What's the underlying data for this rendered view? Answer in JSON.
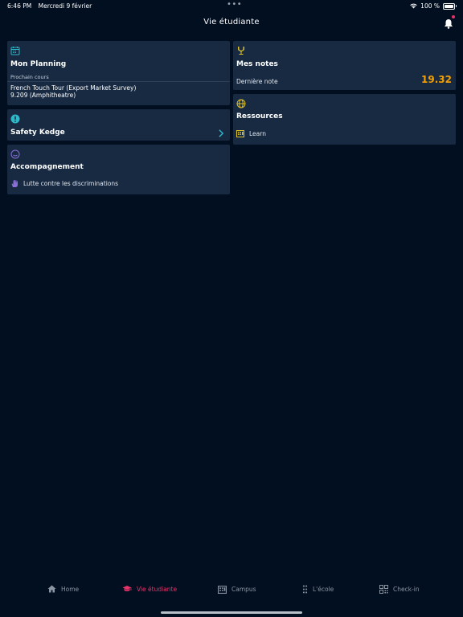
{
  "status_bar": {
    "time": "6:46 PM",
    "date": "Mercredi 9 février",
    "multitask_dots": "•••",
    "battery": "100 %"
  },
  "header": {
    "title": "Vie étudiante"
  },
  "cards": {
    "planning": {
      "title": "Mon Planning",
      "next_label": "Prochain cours",
      "course_name": "French Touch Tour (Export Market Survey)",
      "course_room": "9.209 (Amphitheatre)"
    },
    "safety": {
      "title": "Safety Kedge"
    },
    "accompagnement": {
      "title": "Accompagnement",
      "item_label": "Lutte contre les discriminations"
    },
    "notes": {
      "title": "Mes notes",
      "last_label": "Dernière note",
      "last_value": "19.32"
    },
    "ressources": {
      "title": "Ressources",
      "item_label": "Learn"
    }
  },
  "tab_bar": {
    "items": [
      {
        "label": "Home",
        "icon": "home-icon"
      },
      {
        "label": "Vie étudiante",
        "icon": "graduation-cap-icon"
      },
      {
        "label": "Campus",
        "icon": "building-icon"
      },
      {
        "label": "L'école",
        "icon": "dots-grid-icon"
      },
      {
        "label": "Check-in",
        "icon": "qr-code-icon"
      }
    ],
    "active_index": 1
  },
  "colors": {
    "background": "#020f20",
    "card": "#172a42",
    "accent_pink": "#e8336a",
    "accent_yellow": "#e0c22a",
    "accent_teal": "#2fb7c8",
    "accent_purple": "#8a6fd8",
    "grade_orange": "#f4a000"
  }
}
